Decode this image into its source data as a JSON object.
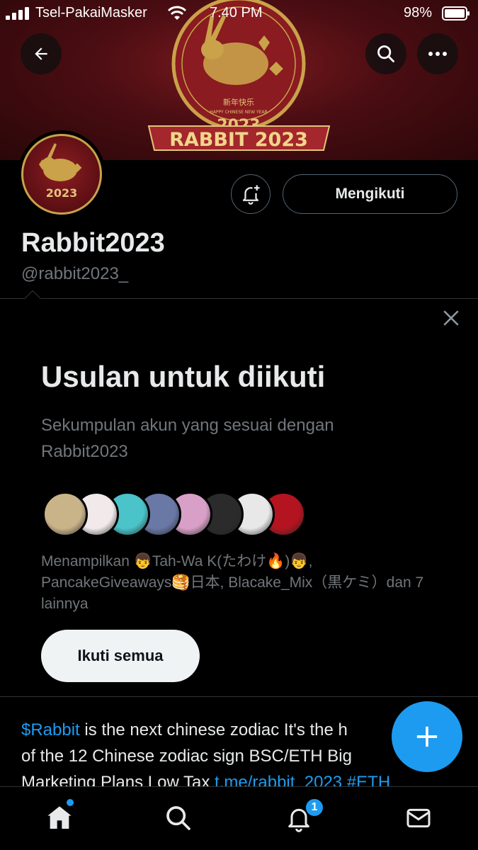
{
  "status_bar": {
    "carrier": "Tsel-PakaiMasker",
    "time": "7.40 PM",
    "battery": "98%"
  },
  "banner": {
    "year": "2023",
    "chinese_text": "新年快乐",
    "subtitle": "HAPPY CHINESE NEW YEAR",
    "ribbon": "RABBIT 2023"
  },
  "profile": {
    "display_name": "Rabbit2023",
    "handle": "@rabbit2023_",
    "follow_label": "Mengikuti"
  },
  "suggest": {
    "title": "Usulan untuk diikuti",
    "subtitle": "Sekumpulan akun yang sesuai dengan Rabbit2023",
    "showing": "Menampilkan 👦Tah-Wa K(たわけ🔥)👦, PancakeGiveaways🥞日本, Blacake_Mix（黒ケミ）dan 7 lainnya",
    "follow_all_label": "Ikuti semua",
    "avatar_colors": [
      "#c9b48a",
      "#f2eaea",
      "#4ac3c9",
      "#6a78a6",
      "#d9a0c7",
      "#2b2b2b",
      "#e8e8e8",
      "#b3141f"
    ]
  },
  "bio": {
    "link1": "$Rabbit",
    "text1": " is the next chinese zodiac It's the h",
    "text2": "of the 12 Chinese zodiac sign BSC/ETH Big",
    "text3": "Marketing Plans Low Tax ",
    "link2": "t.me/rabbit_2023",
    "link3": " #ETH"
  },
  "nav": {
    "notif_count": "1"
  },
  "colors": {
    "accent": "#1d9bf0",
    "muted": "#71767b",
    "border": "#2f3336"
  }
}
